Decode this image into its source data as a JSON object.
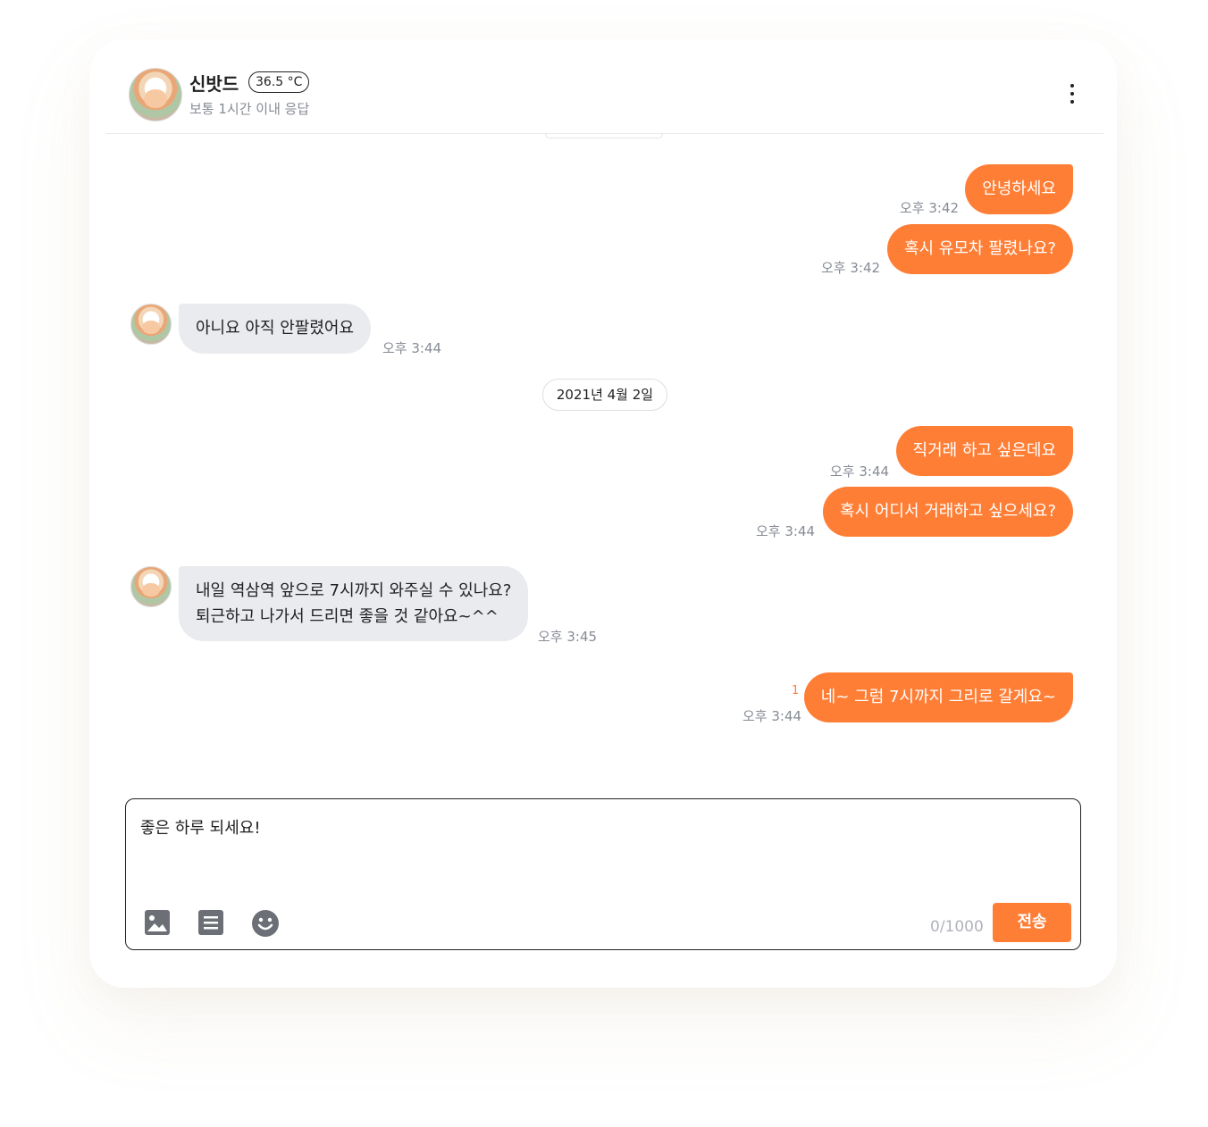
{
  "header": {
    "username": "신밧드",
    "temperature": "36.5 °C",
    "response_time": "보통 1시간 이내 응답"
  },
  "chat": {
    "date_divider": "2021년 4월 2일",
    "messages": [
      {
        "direction": "out",
        "text": "안녕하세요",
        "time": "오후 3:42"
      },
      {
        "direction": "out",
        "text": "혹시 유모차 팔렸나요?",
        "time": "오후 3:42"
      },
      {
        "direction": "in",
        "text": "아니요 아직 안팔렸어요",
        "time": "오후 3:44"
      },
      {
        "direction": "out",
        "text": "직거래 하고 싶은데요",
        "time": "오후 3:44"
      },
      {
        "direction": "out",
        "text": "혹시 어디서 거래하고 싶으세요?",
        "time": "오후 3:44"
      },
      {
        "direction": "in",
        "line1": "내일 역삼역 앞으로 7시까지 와주실 수 있나요?",
        "line2": "퇴근하고 나가서 드리면 좋을 것 같아요~^^",
        "time": "오후 3:45"
      },
      {
        "direction": "out",
        "text": "네~ 그럼 7시까지 그리로 갈게요~",
        "time": "오후 3:44",
        "unread": "1"
      }
    ]
  },
  "composer": {
    "text": "좋은 하루 되세요!",
    "counter": "0/1000",
    "send_label": "전송",
    "icons": [
      "image-icon",
      "document-icon",
      "emoji-icon"
    ]
  },
  "colors": {
    "accent": "#ff7e36",
    "incoming_bubble": "#eaebee",
    "muted_text": "#868b94"
  }
}
